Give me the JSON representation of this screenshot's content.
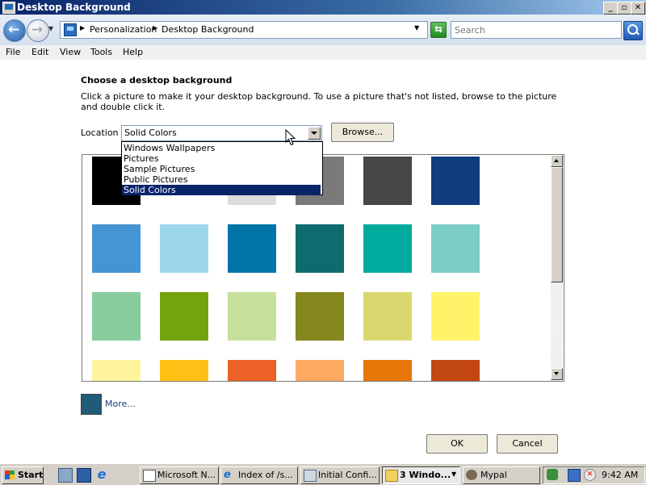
{
  "window": {
    "title": "Desktop Background",
    "controls": {
      "minimize": "_",
      "maximize": "▫",
      "close": "✕"
    }
  },
  "address": {
    "crumbs": [
      "Personalization",
      "Desktop Background"
    ],
    "search_placeholder": "Search"
  },
  "menu": [
    "File",
    "Edit",
    "View",
    "Tools",
    "Help"
  ],
  "content": {
    "heading": "Choose a desktop background",
    "description": "Click a picture to make it your desktop background. To use a picture that's not listed, browse to the picture and double click it.",
    "location_label": "Location",
    "location_value": "Solid Colors",
    "browse_label": "Browse...",
    "location_options": [
      "Windows Wallpapers",
      "Pictures",
      "Sample Pictures",
      "Public Pictures",
      "Solid Colors"
    ],
    "selected_option": "Solid Colors",
    "swatches": [
      [
        "#000000",
        "#ffffff",
        "#dcdcdc",
        "#7a7a7a",
        "#474747",
        "#0f3c7e"
      ],
      [
        "#4594d4",
        "#9dd7ec",
        "#0073a7",
        "#0e6b6e",
        "#00ab9e",
        "#7ccdc8"
      ],
      [
        "#88cc9d",
        "#73a40d",
        "#c5e09b",
        "#85871f",
        "#d9d86f",
        "#fff36a"
      ],
      [
        "#fff59f",
        "#fdc115",
        "#ec6125",
        "#fdab61",
        "#e87709",
        "#c24711"
      ]
    ],
    "more_label": "More...",
    "more_color": "#205b78",
    "ok_label": "OK",
    "cancel_label": "Cancel"
  },
  "taskbar": {
    "start_label": "Start",
    "tasks": [
      {
        "label": "Microsoft N...",
        "icon": "document-icon"
      },
      {
        "label": "Index of /s...",
        "icon": "ie-icon"
      },
      {
        "label": "Initial Confi...",
        "icon": "config-icon"
      },
      {
        "label": "3 Windo...",
        "icon": "folder-icon"
      },
      {
        "label": "Mypal",
        "icon": "mypal-icon"
      }
    ],
    "clock": "9:42 AM"
  }
}
